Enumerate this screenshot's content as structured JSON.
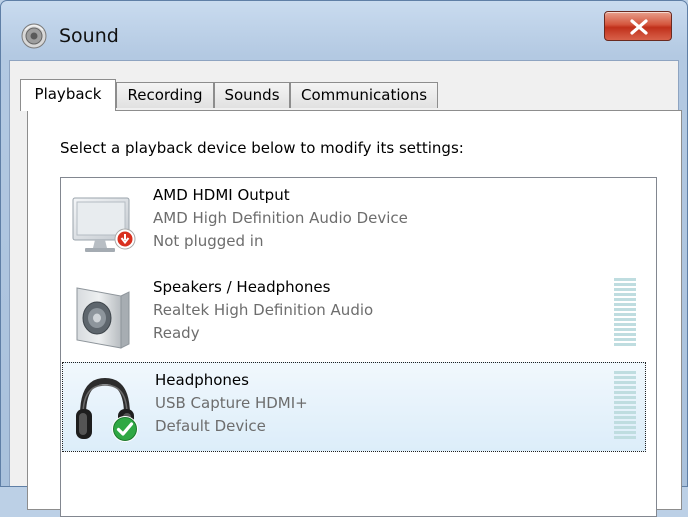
{
  "window": {
    "title": "Sound",
    "title_icon": "speaker-icon",
    "close_icon": "close-icon"
  },
  "tabs": [
    {
      "label": "Playback",
      "active": true
    },
    {
      "label": "Recording",
      "active": false
    },
    {
      "label": "Sounds",
      "active": false
    },
    {
      "label": "Communications",
      "active": false
    }
  ],
  "instruction": "Select a playback device below to modify its settings:",
  "devices": [
    {
      "name": "AMD HDMI Output",
      "description": "AMD High Definition Audio Device",
      "status": "Not plugged in",
      "icon": "monitor-icon",
      "badge": "unplugged-badge-icon",
      "selected": false
    },
    {
      "name": "Speakers / Headphones",
      "description": "Realtek High Definition Audio",
      "status": "Ready",
      "icon": "speaker-device-icon",
      "selected": false
    },
    {
      "name": "Headphones",
      "description": "USB Capture HDMI+",
      "status": "Default Device",
      "icon": "headphones-icon",
      "badge": "default-check-icon",
      "selected": true
    }
  ],
  "colors": {
    "close_button": "#c0301b",
    "meter_bar": "#bfdde0",
    "selection": "#dcedf9",
    "secondary_text": "#6d6d6d"
  }
}
